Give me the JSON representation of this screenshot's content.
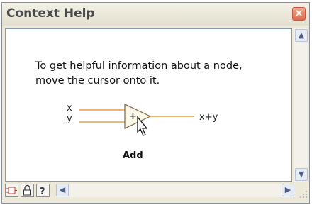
{
  "window": {
    "title": "Context Help"
  },
  "help": {
    "message_line1": "To get helpful information about a node,",
    "message_line2": "move the cursor onto it."
  },
  "diagram": {
    "input_x": "x",
    "input_y": "y",
    "output": "x+y",
    "operator": "+",
    "node_name": "Add"
  },
  "toolbar": {
    "icons": [
      "show-optional-terminals-icon",
      "lock-icon",
      "detailed-help-icon"
    ]
  },
  "colors": {
    "wire": "#e6a23c",
    "accent": "#db6a4f"
  }
}
